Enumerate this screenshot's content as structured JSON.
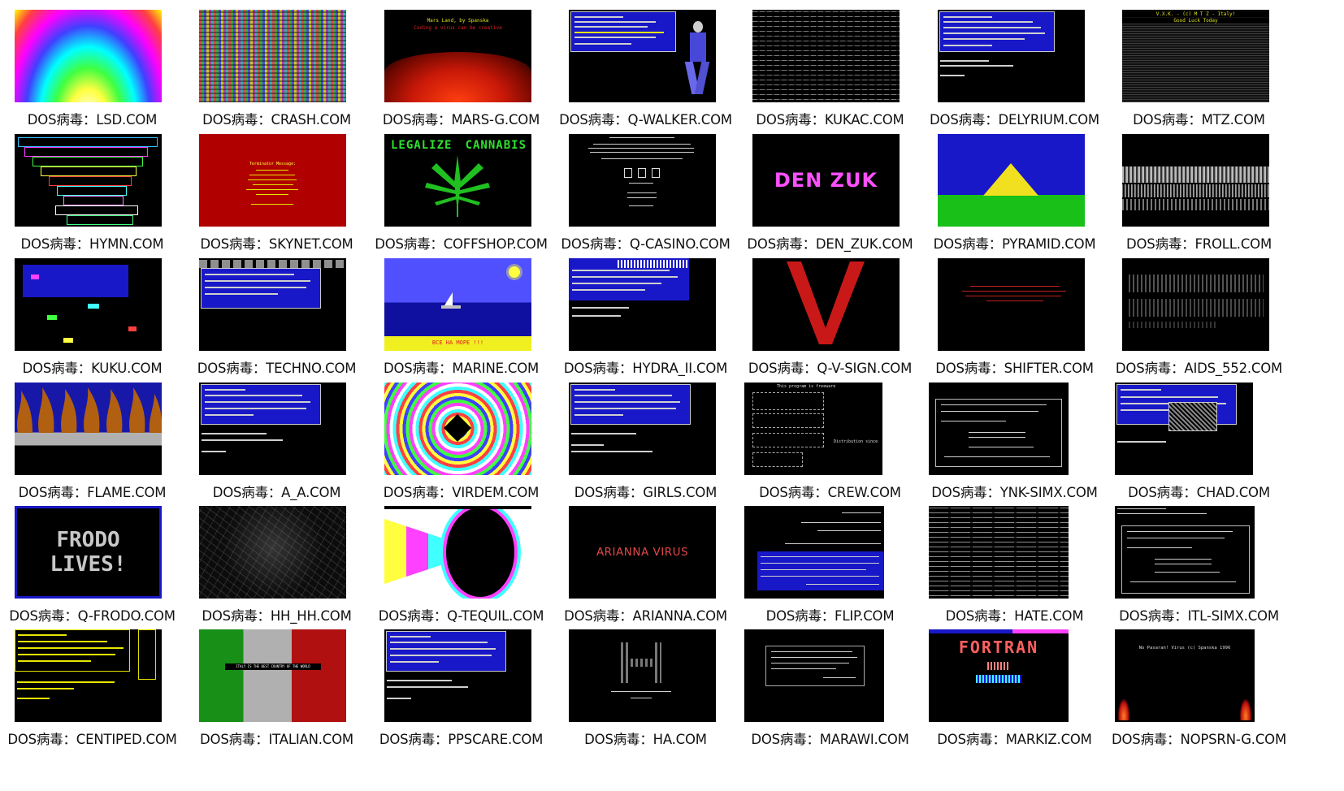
{
  "items": [
    {
      "label": "DOS病毒：LSD.COM",
      "icon": "lsd-thumbnail"
    },
    {
      "label": "DOS病毒：CRASH.COM",
      "icon": "crash-thumbnail"
    },
    {
      "label": "DOS病毒：MARS-G.COM",
      "icon": "mars-g-thumbnail",
      "text": "Mars Land, by Spanska",
      "text2": "Coding a virus can be creative"
    },
    {
      "label": "DOS病毒：Q-WALKER.COM",
      "icon": "q-walker-thumbnail"
    },
    {
      "label": "DOS病毒：KUKAC.COM",
      "icon": "kukac-thumbnail"
    },
    {
      "label": "DOS病毒：DELYRIUM.COM",
      "icon": "delyrium-thumbnail"
    },
    {
      "label": "DOS病毒：MTZ.COM",
      "icon": "mtz-thumbnail",
      "text": "V.X.K. - (c) M T Z - Italy!",
      "text2": "Good Luck Today"
    },
    {
      "label": "DOS病毒：HYMN.COM",
      "icon": "hymn-thumbnail"
    },
    {
      "label": "DOS病毒：SKYNET.COM",
      "icon": "skynet-thumbnail",
      "text": "Terminator Message:"
    },
    {
      "label": "DOS病毒：COFFSHOP.COM",
      "icon": "coffshop-thumbnail",
      "text": "LEGALIZE",
      "text2": "CANNABIS"
    },
    {
      "label": "DOS病毒：Q-CASINO.COM",
      "icon": "q-casino-thumbnail"
    },
    {
      "label": "DOS病毒：DEN_ZUK.COM",
      "icon": "den-zuk-thumbnail",
      "text": "DEN ZUK"
    },
    {
      "label": "DOS病毒：PYRAMID.COM",
      "icon": "pyramid-thumbnail"
    },
    {
      "label": "DOS病毒：FROLL.COM",
      "icon": "froll-thumbnail"
    },
    {
      "label": "DOS病毒：KUKU.COM",
      "icon": "kuku-thumbnail"
    },
    {
      "label": "DOS病毒：TECHNO.COM",
      "icon": "techno-thumbnail"
    },
    {
      "label": "DOS病毒：MARINE.COM",
      "icon": "marine-thumbnail",
      "text": "ВСЕ НА МОРЕ !!!"
    },
    {
      "label": "DOS病毒：HYDRA_II.COM",
      "icon": "hydra-ii-thumbnail"
    },
    {
      "label": "DOS病毒：Q-V-SIGN.COM",
      "icon": "q-v-sign-thumbnail"
    },
    {
      "label": "DOS病毒：SHIFTER.COM",
      "icon": "shifter-thumbnail"
    },
    {
      "label": "DOS病毒：AIDS_552.COM",
      "icon": "aids-552-thumbnail"
    },
    {
      "label": "DOS病毒：FLAME.COM",
      "icon": "flame-thumbnail"
    },
    {
      "label": "DOS病毒：A_A.COM",
      "icon": "a-a-thumbnail"
    },
    {
      "label": "DOS病毒：VIRDEM.COM",
      "icon": "virdem-thumbnail"
    },
    {
      "label": "DOS病毒：GIRLS.COM",
      "icon": "girls-thumbnail"
    },
    {
      "label": "DOS病毒：CREW.COM",
      "icon": "crew-thumbnail",
      "text": "This program is freeware",
      "text2": "Distribution since"
    },
    {
      "label": "DOS病毒：YNK-SIMX.COM",
      "icon": "ynk-simx-thumbnail"
    },
    {
      "label": "DOS病毒：CHAD.COM",
      "icon": "chad-thumbnail"
    },
    {
      "label": "DOS病毒：Q-FRODO.COM",
      "icon": "q-frodo-thumbnail",
      "text": "FRODO",
      "text2": "LIVES!"
    },
    {
      "label": "DOS病毒：HH_HH.COM",
      "icon": "hh-hh-thumbnail"
    },
    {
      "label": "DOS病毒：Q-TEQUIL.COM",
      "icon": "q-tequil-thumbnail"
    },
    {
      "label": "DOS病毒：ARIANNA.COM",
      "icon": "arianna-thumbnail",
      "text": "ARIANNA VIRUS"
    },
    {
      "label": "DOS病毒：FLIP.COM",
      "icon": "flip-thumbnail"
    },
    {
      "label": "DOS病毒：HATE.COM",
      "icon": "hate-thumbnail"
    },
    {
      "label": "DOS病毒：ITL-SIMX.COM",
      "icon": "itl-simx-thumbnail"
    },
    {
      "label": "DOS病毒：CENTIPED.COM",
      "icon": "centiped-thumbnail"
    },
    {
      "label": "DOS病毒：ITALIAN.COM",
      "icon": "italian-thumbnail",
      "text": "ITALY IS THE BEST COUNTRY OF THE WORLD"
    },
    {
      "label": "DOS病毒：PPSCARE.COM",
      "icon": "ppscare-thumbnail"
    },
    {
      "label": "DOS病毒：HA.COM",
      "icon": "ha-thumbnail"
    },
    {
      "label": "DOS病毒：MARAWI.COM",
      "icon": "marawi-thumbnail"
    },
    {
      "label": "DOS病毒：MARKIZ.COM",
      "icon": "markiz-thumbnail",
      "text": "FORTRAN"
    },
    {
      "label": "DOS病毒：NOPSRN-G.COM",
      "icon": "nopsrn-g-thumbnail",
      "text": "No Pasaran! Virus (c) Spanska 1996"
    }
  ]
}
